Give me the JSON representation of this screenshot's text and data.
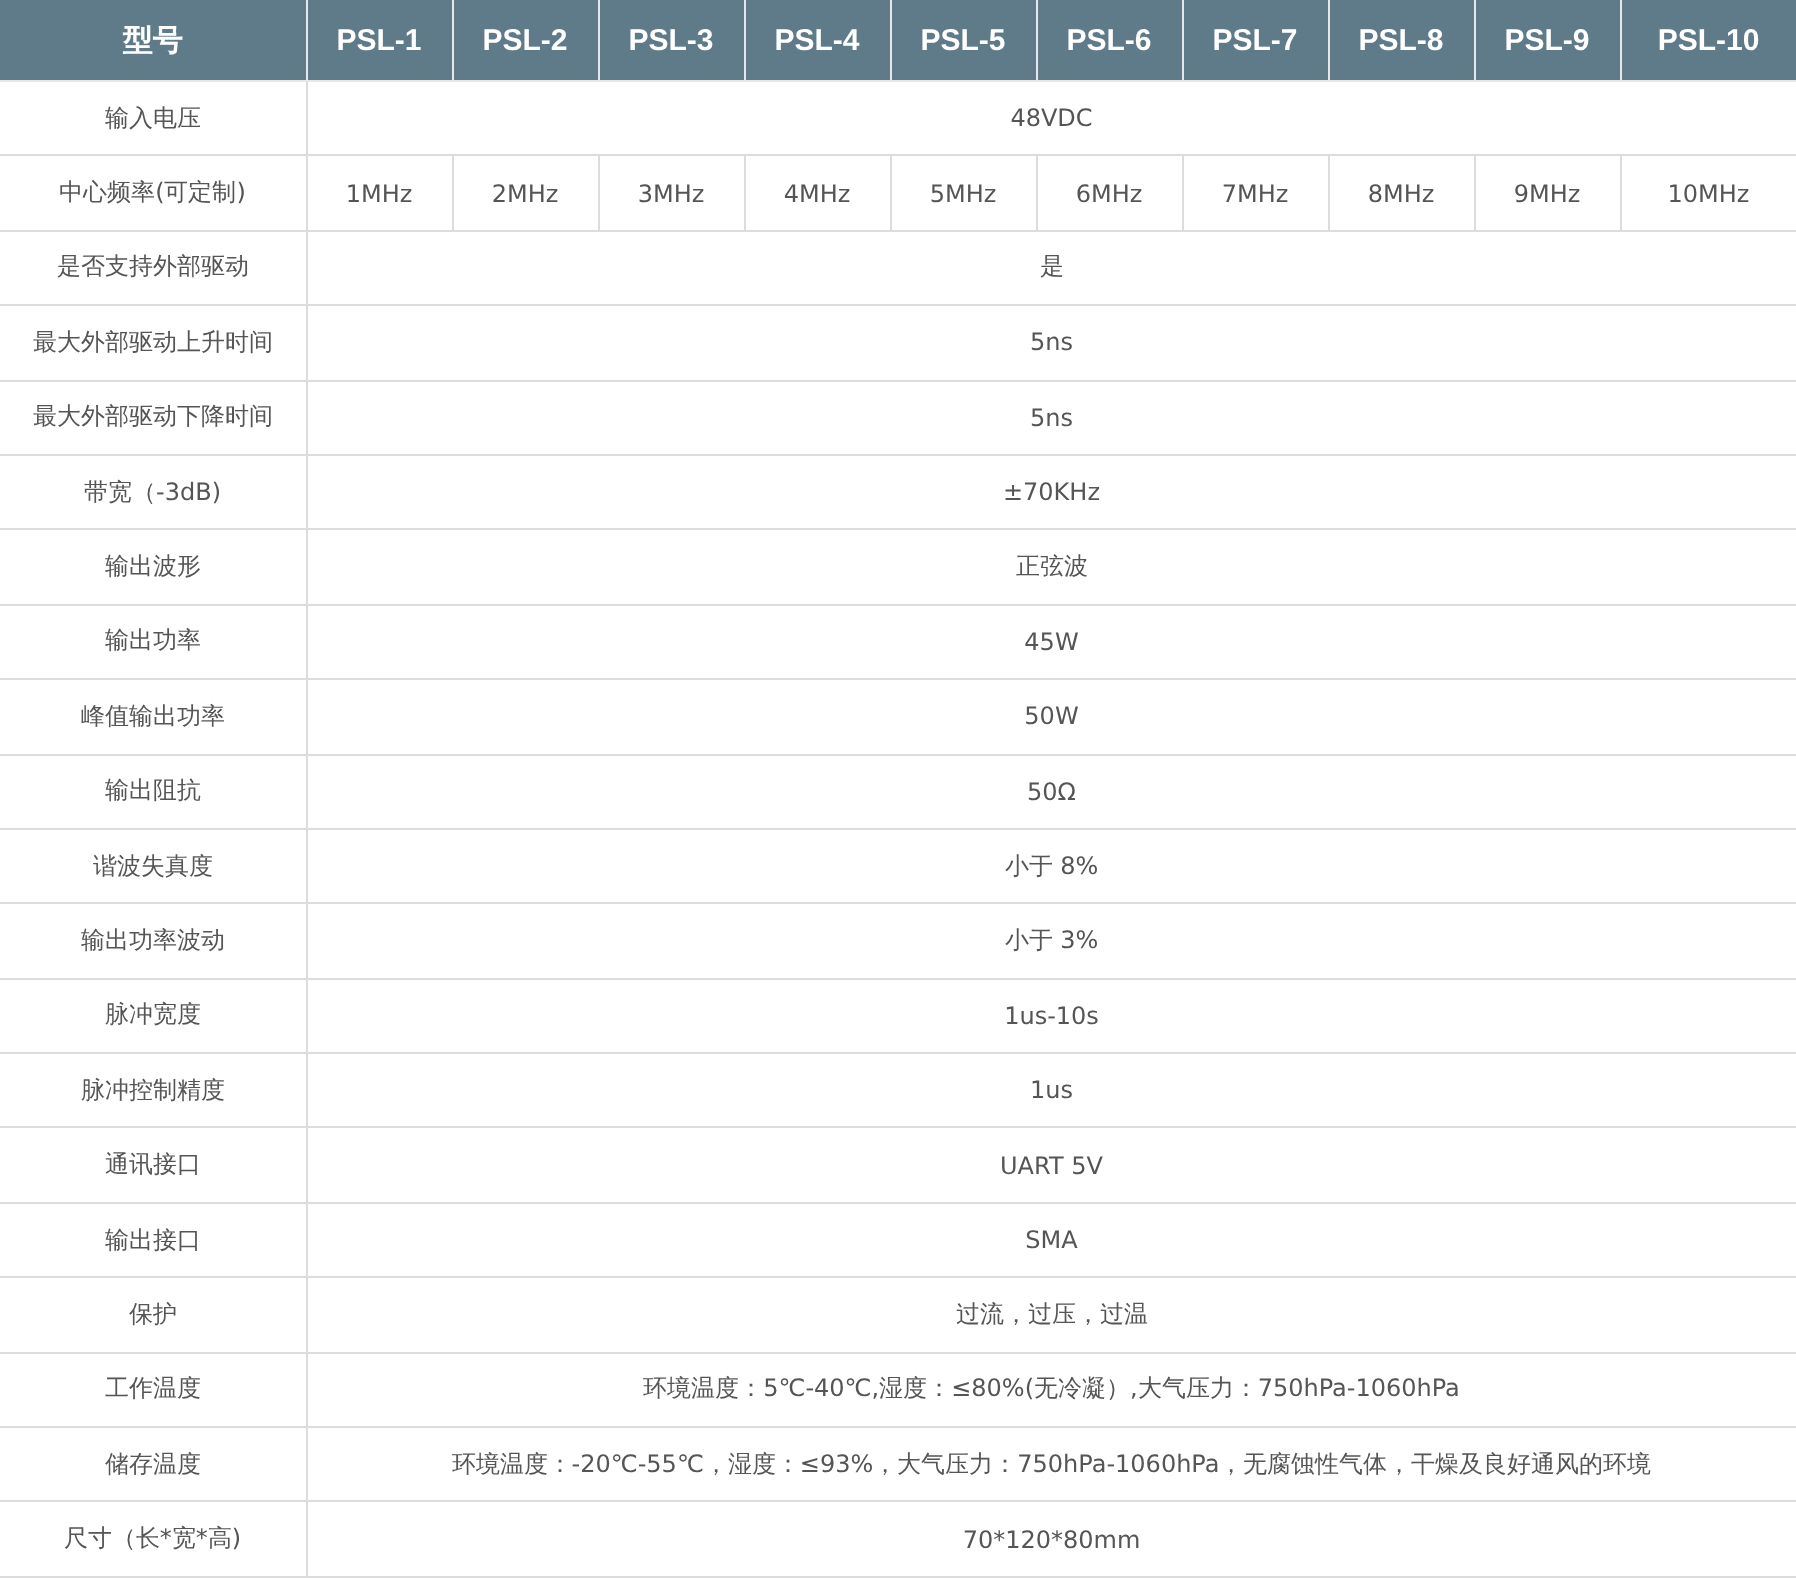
{
  "table": {
    "columns": [
      "型号",
      "PSL-1",
      "PSL-2",
      "PSL-3",
      "PSL-4",
      "PSL-5",
      "PSL-6",
      "PSL-7",
      "PSL-8",
      "PSL-9",
      "PSL-10"
    ],
    "rows": [
      {
        "label": "输入电压",
        "values": [
          "48VDC"
        ]
      },
      {
        "label": "中心频率(可定制)",
        "values": [
          "1MHz",
          "2MHz",
          "3MHz",
          "4MHz",
          "5MHz",
          "6MHz",
          "7MHz",
          "8MHz",
          "9MHz",
          "10MHz"
        ]
      },
      {
        "label": "是否支持外部驱动",
        "values": [
          "是"
        ]
      },
      {
        "label": "最大外部驱动上升时间",
        "values": [
          "5ns"
        ]
      },
      {
        "label": "最大外部驱动下降时间",
        "values": [
          "5ns"
        ]
      },
      {
        "label": "带宽（-3dB)",
        "values": [
          "±70KHz"
        ]
      },
      {
        "label": "输出波形",
        "values": [
          "正弦波"
        ]
      },
      {
        "label": "输出功率",
        "values": [
          "45W"
        ]
      },
      {
        "label": "峰值输出功率",
        "values": [
          "50W"
        ]
      },
      {
        "label": "输出阻抗",
        "values": [
          "50Ω"
        ]
      },
      {
        "label": "谐波失真度",
        "values": [
          "小于 8%"
        ]
      },
      {
        "label": "输出功率波动",
        "values": [
          "小于 3%"
        ]
      },
      {
        "label": "脉冲宽度",
        "values": [
          "1us-10s"
        ]
      },
      {
        "label": "脉冲控制精度",
        "values": [
          "1us"
        ]
      },
      {
        "label": "通讯接口",
        "values": [
          "UART 5V"
        ]
      },
      {
        "label": "输出接口",
        "values": [
          "SMA"
        ]
      },
      {
        "label": "保护",
        "values": [
          "过流，过压，过温"
        ]
      },
      {
        "label": "工作温度",
        "values": [
          "环境温度：5℃-40℃,湿度：≤80%(无冷凝）,大气压力：750hPa-1060hPa"
        ]
      },
      {
        "label": "储存温度",
        "values": [
          "环境温度：-20℃-55℃，湿度：≤93%，大气压力：750hPa-1060hPa，无腐蚀性气体，干燥及良好通风的环境"
        ]
      },
      {
        "label": "尺寸（长*宽*高)",
        "values": [
          "70*120*80mm"
        ]
      }
    ]
  }
}
